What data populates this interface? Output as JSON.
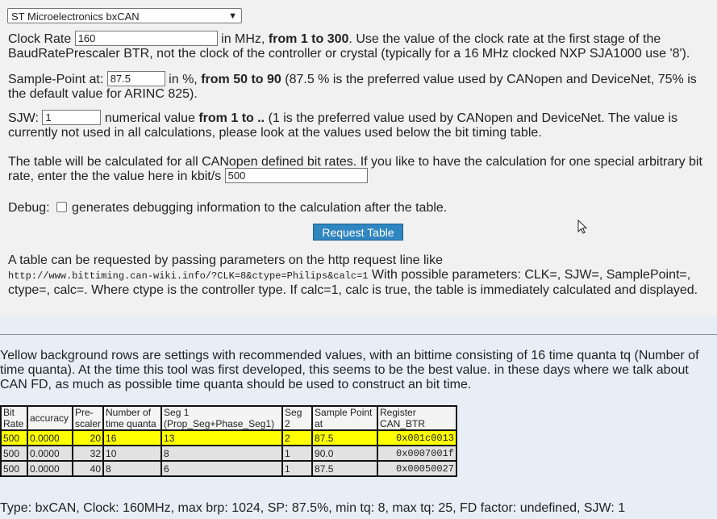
{
  "controller_select": {
    "value": "ST Microelectronics bxCAN"
  },
  "clock_rate": {
    "label": "Clock Rate",
    "value": "160",
    "after": " in MHz, ",
    "range": "from 1 to 300",
    "desc": ". Use the value of the clock rate at the first stage of the BaudRatePrescaler BTR, not the clock of the controller or crystal (typically for a 16 MHz clocked NXP SJA1000 use '8')."
  },
  "sample_point": {
    "label": "Sample-Point at:",
    "value": "87.5",
    "after": " in %, ",
    "range": "from 50 to 90",
    "desc": " (87.5 % is the preferred value used by CANopen and DeviceNet, 75% is the default value for ARINC 825)."
  },
  "sjw": {
    "label": "SJW:",
    "value": "1",
    "after": " numerical value ",
    "range": "from 1 to ..",
    "desc": " (1 is the preferred value used by CANopen and DeviceNet. The value is currently not used in all calculations, please look at the values used below the bit timing table."
  },
  "bitrate": {
    "text": "The table will be calculated for all CANopen defined bit rates. If you like to have the calculation for one special arbitrary bit rate, enter the the value here in kbit/s",
    "value": "500"
  },
  "debug": {
    "label": "Debug:",
    "desc": "generates debugging information to the calculation after the table."
  },
  "request_button": {
    "label": "Request Table"
  },
  "request_info": {
    "intro": "A table can be requested by passing parameters on the http request line like",
    "url": "http://www.bittiming.can-wiki.info/?CLK=8&ctype=Philips&calc=1",
    "desc": " With possible parameters: CLK=, SJW=, SamplePoint=, ctype=, calc=. Where ctype is the controller type. If calc=1, calc is true, the table is immediately calculated and displayed."
  },
  "note": "Yellow background rows are settings with recommended values, with an bittime consisting of 16 time quanta tq (Number of time quanta). At the time this tool was first developed, this seems to be the best value. in these days where we talk about CAN FD, as much as possible time quanta should be used to construct an bit time.",
  "table": {
    "headers": {
      "bit_rate": "Bit Rate",
      "accuracy": "accuracy",
      "prescaler": "Pre-scaler",
      "tq": "Number of time quanta",
      "seg1": "Seg 1 (Prop_Seg+Phase_Seg1)",
      "seg2": "Seg 2",
      "sp": "Sample Point at",
      "reg": "Register CAN_BTR"
    },
    "rows": [
      {
        "bit_rate": "500",
        "accuracy": "0.0000",
        "prescaler": "20",
        "tq": "16",
        "seg1": "13",
        "seg2": "2",
        "sp": "87.5",
        "reg": "0x001c0013"
      },
      {
        "bit_rate": "500",
        "accuracy": "0.0000",
        "prescaler": "32",
        "tq": "10",
        "seg1": "8",
        "seg2": "1",
        "sp": "90.0",
        "reg": "0x0007001f"
      },
      {
        "bit_rate": "500",
        "accuracy": "0.0000",
        "prescaler": "40",
        "tq": "8",
        "seg1": "6",
        "seg2": "1",
        "sp": "87.5",
        "reg": "0x00050027"
      }
    ]
  },
  "summary": "Type: bxCAN, Clock: 160MHz, max brp: 1024, SP: 87.5%, min tq: 8, max tq: 25, FD factor: undefined, SJW: 1"
}
